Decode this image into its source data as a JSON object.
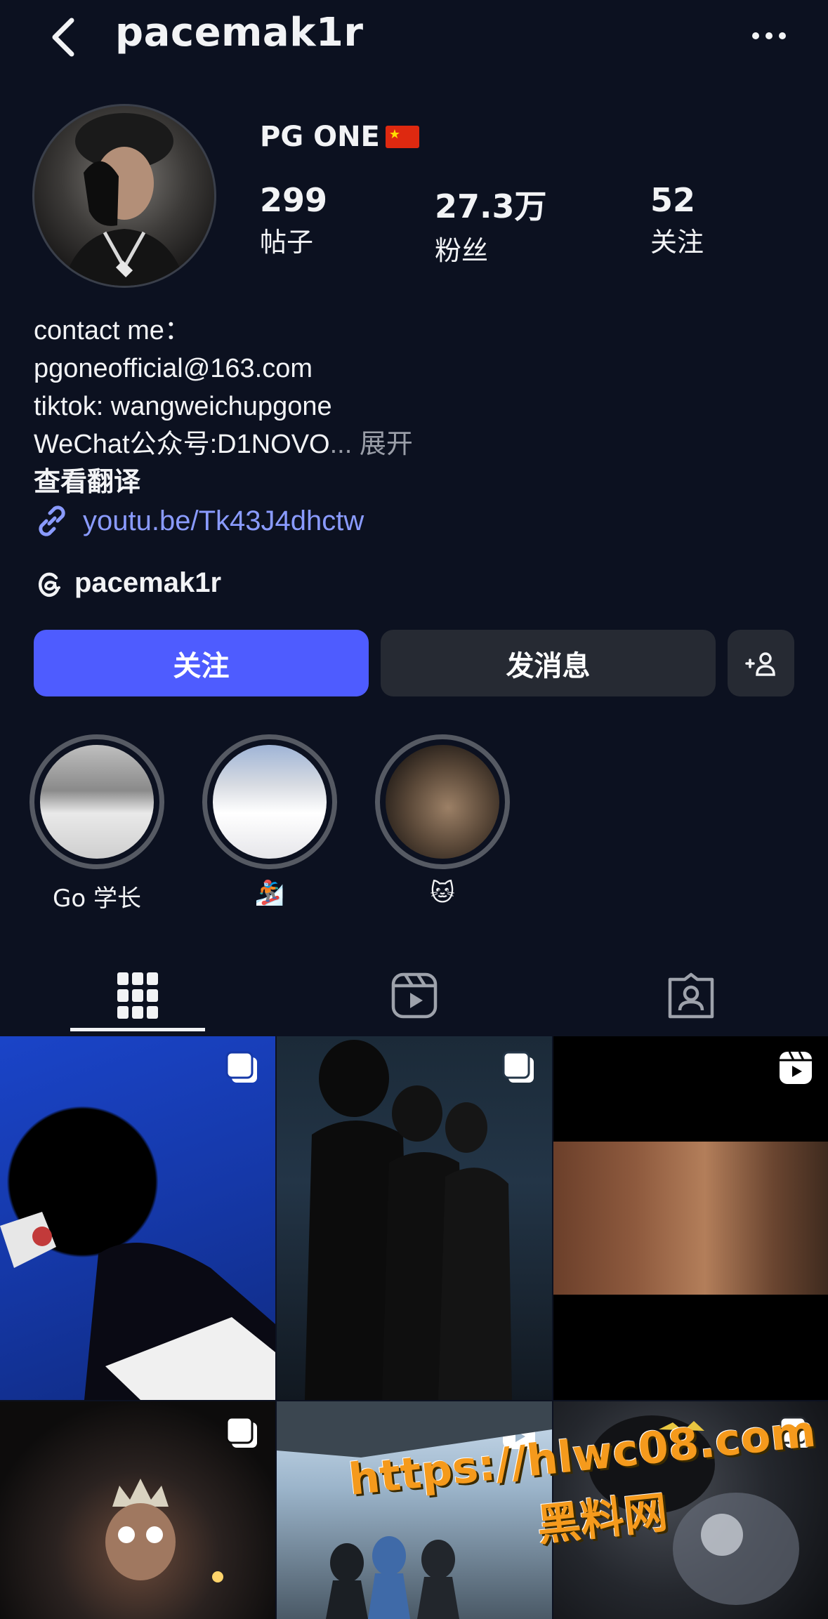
{
  "header": {
    "username": "pacemak1r"
  },
  "profile": {
    "display_name": "PG ONE",
    "flag": "cn-flag",
    "stats": [
      {
        "value": "299",
        "label": "帖子"
      },
      {
        "value": "27.3万",
        "label": "粉丝"
      },
      {
        "value": "52",
        "label": "关注"
      }
    ],
    "bio_lines": [
      "contact me：",
      "pgoneofficial@163.com",
      "tiktok: wangweichupgone",
      "WeChat公众号:D1NOVO"
    ],
    "bio_ellipsis": "...",
    "expand_label": "展开",
    "translate_label": "查看翻译",
    "link": "youtu.be/Tk43J4dhctw",
    "threads_handle": "pacemak1r"
  },
  "actions": {
    "follow_label": "关注",
    "message_label": "发消息"
  },
  "highlights": [
    {
      "label": "Go 学长"
    },
    {
      "label": "🏂"
    },
    {
      "label": "🐱"
    }
  ],
  "tabs": [
    "grid-icon",
    "reels-icon",
    "tagged-icon"
  ],
  "watermark": {
    "url": "https://hlwc08.com",
    "name": "黑料网"
  },
  "colors": {
    "background": "#0c1120",
    "follow_button": "#4e5cff",
    "secondary_button": "#262a33",
    "link": "#8a9bff",
    "watermark": "#f59a1c"
  }
}
